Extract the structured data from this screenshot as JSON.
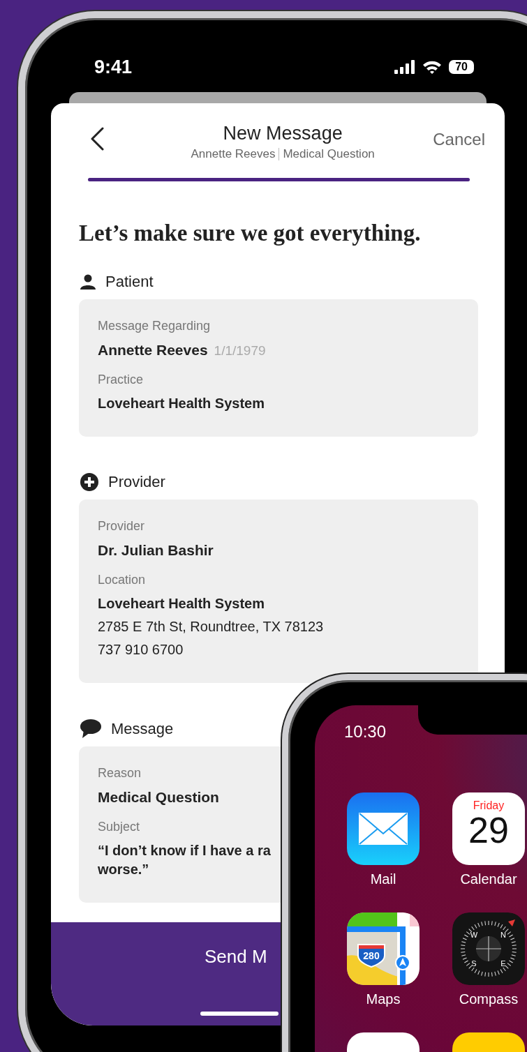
{
  "phone": {
    "status_bar": {
      "time": "9:41",
      "battery": "70"
    },
    "header": {
      "title": "New Message",
      "subtitle": [
        "Annette Reeves",
        "Medical Question"
      ],
      "cancel": "Cancel"
    },
    "progress": {
      "level": 1
    },
    "heading": "Let’s make sure we got everything.",
    "sections": [
      {
        "title": "Patient",
        "fields": [
          {
            "label": "Message Regarding",
            "value": "Annette Reeves",
            "note": "1/1/1979"
          },
          {
            "label": "Practice",
            "value": "Loveheart Health System"
          }
        ]
      },
      {
        "title": "Provider",
        "fields": [
          {
            "label": "Provider",
            "value": "Dr. Julian Bashir"
          },
          {
            "label": "Location",
            "value": "Loveheart Health System",
            "lines": [
              "2785 E 7th St, Roundtree, TX 78123",
              "737 910 6700"
            ]
          }
        ]
      },
      {
        "title": "Message",
        "fields": [
          {
            "label": "Reason",
            "value": "Medical Question"
          },
          {
            "label": "Subject",
            "value": "“I don’t know if I have a ra",
            "lines": [
              "worse.”"
            ]
          }
        ]
      }
    ],
    "send_button": "Send M"
  },
  "home_phone": {
    "time": "10:30",
    "apps": [
      {
        "kind": "mail",
        "label": "Mail"
      },
      {
        "kind": "calendar",
        "label": "Calendar",
        "day": "Friday",
        "date": "29"
      },
      {
        "kind": "maps",
        "label": "Maps",
        "shield": "280"
      },
      {
        "kind": "compass",
        "label": "Compass",
        "points": [
          "W",
          "N",
          "S",
          "E"
        ]
      }
    ]
  }
}
